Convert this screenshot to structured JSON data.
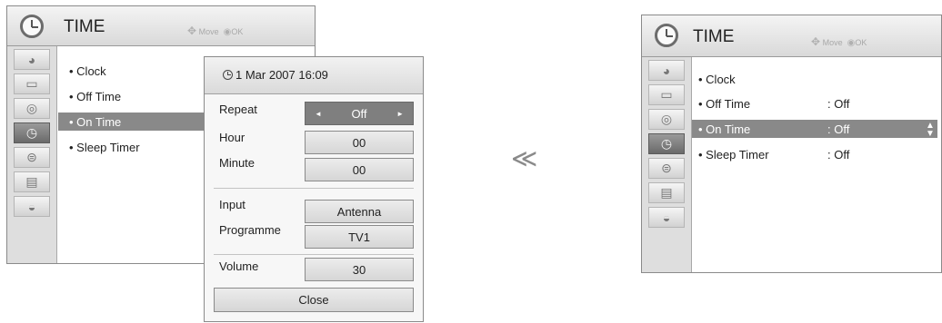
{
  "left_menu": {
    "title": "TIME",
    "hint_move": "Move",
    "hint_ok": "OK",
    "items": [
      {
        "label": "• Clock",
        "highlighted": false
      },
      {
        "label": "• Off Time",
        "highlighted": false
      },
      {
        "label": "• On Time",
        "highlighted": true
      },
      {
        "label": "• Sleep Timer",
        "highlighted": false
      }
    ],
    "popup": {
      "datetime": "1 Mar 2007 16:09",
      "fields": [
        {
          "label": "Repeat",
          "value": "Off"
        },
        {
          "label": "Hour",
          "value": "00"
        },
        {
          "label": "Minute",
          "value": "00"
        },
        {
          "label": "Input",
          "value": "Antenna"
        },
        {
          "label": "Programme",
          "value": "TV1"
        },
        {
          "label": "Volume",
          "value": "30"
        }
      ],
      "close_label": "Close"
    }
  },
  "separator": "≪",
  "right_menu": {
    "title": "TIME",
    "hint_move": "Move",
    "hint_ok": "OK",
    "items": [
      {
        "label": "• Clock",
        "value": "",
        "highlighted": false
      },
      {
        "label": "• Off Time",
        "value": ": Off",
        "highlighted": false
      },
      {
        "label": "• On Time",
        "value": ": Off",
        "highlighted": true
      },
      {
        "label": "• Sleep Timer",
        "value": ": Off",
        "highlighted": false
      }
    ]
  },
  "category_icons": [
    "picture-icon",
    "screen-icon",
    "audio-icon",
    "time-icon",
    "lock-icon",
    "option-icon",
    "usb-icon"
  ],
  "colors": {
    "highlight": "#898989",
    "selected_icon": "#6a6a6a",
    "header": "#d9d9d9"
  }
}
